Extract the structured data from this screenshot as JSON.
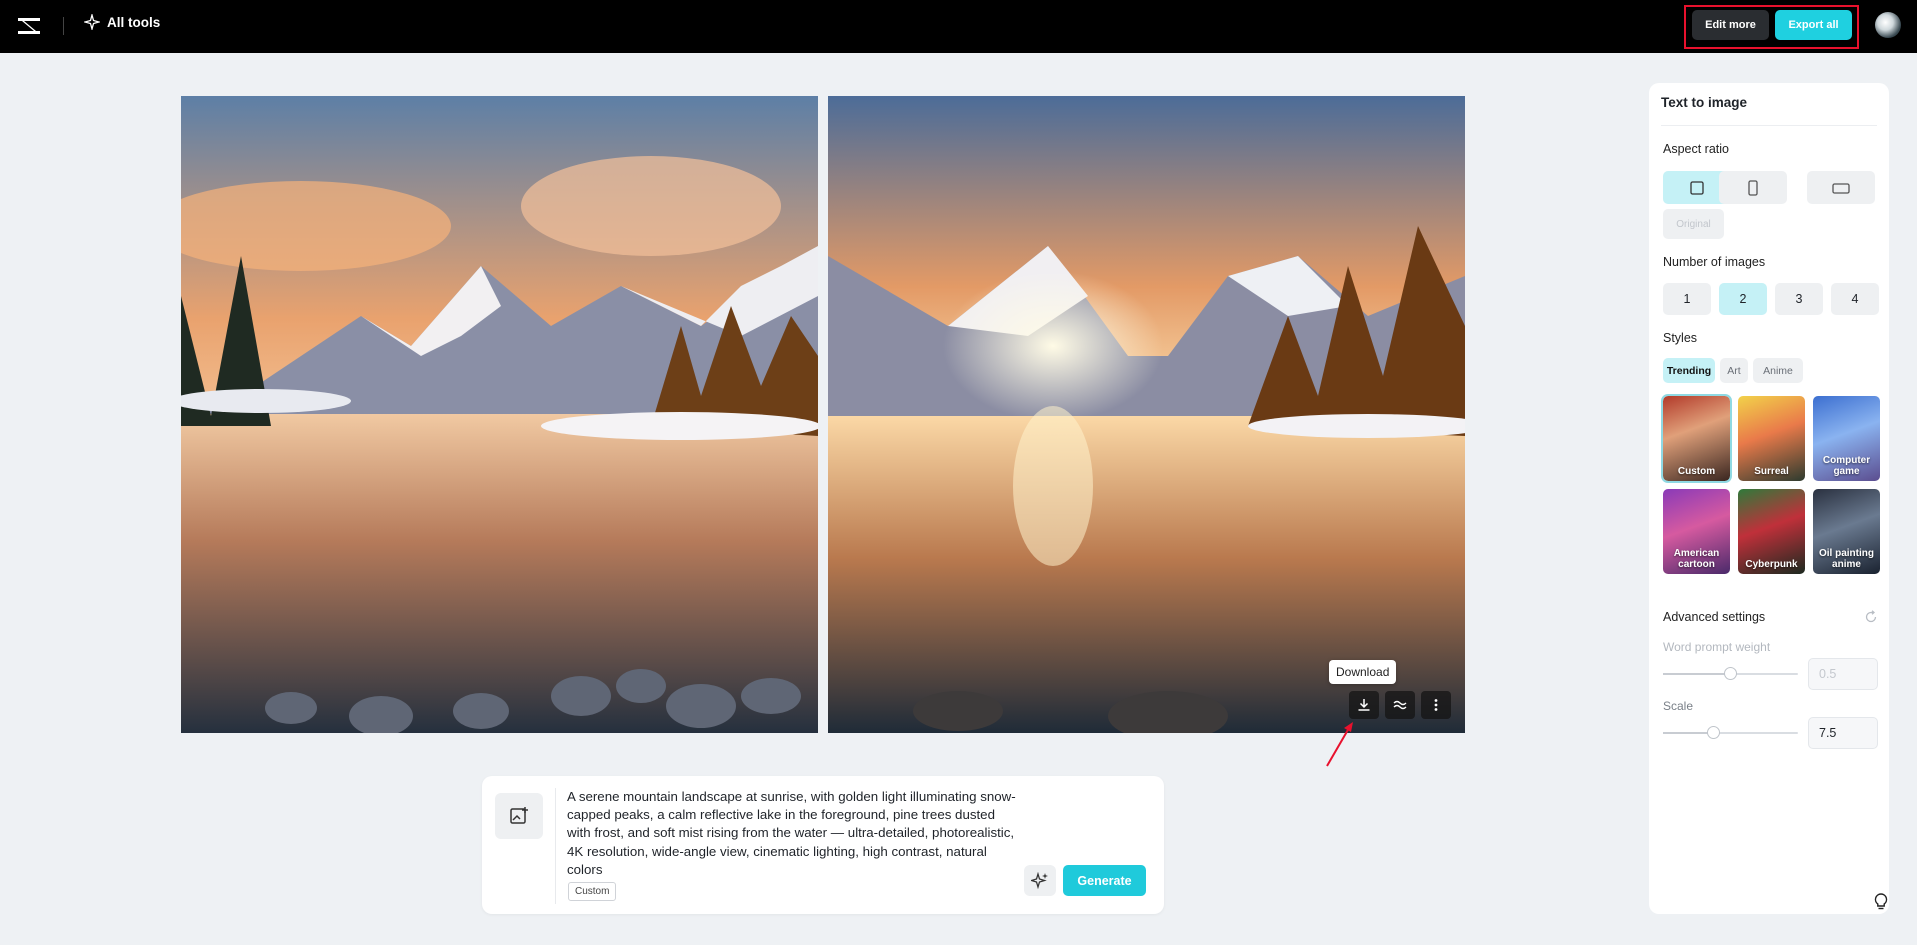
{
  "topbar": {
    "all_tools_label": "All tools",
    "edit_more_label": "Edit more",
    "export_all_label": "Export all"
  },
  "canvas": {
    "tooltip": "Download"
  },
  "prompt": {
    "text": "A serene mountain landscape at sunrise, with golden light illuminating snow-capped peaks, a calm reflective lake in the foreground, pine trees dusted with frost, and soft mist rising from the water — ultra-detailed, photorealistic, 4K resolution, wide-angle view, cinematic lighting, high contrast, natural colors",
    "style_chip": "Custom",
    "generate_label": "Generate"
  },
  "panel": {
    "title": "Text to image",
    "aspect_ratio_label": "Aspect ratio",
    "aspect_original_label": "Original",
    "number_of_images_label": "Number of images",
    "numbers": [
      "1",
      "2",
      "3",
      "4"
    ],
    "selected_number": "2",
    "styles_label": "Styles",
    "style_tabs": [
      "Trending",
      "Art",
      "Anime"
    ],
    "styles": [
      "Custom",
      "Surreal",
      "Computer game",
      "American cartoon",
      "Cyberpunk",
      "Oil painting anime"
    ],
    "advanced_settings_label": "Advanced settings",
    "word_prompt_weight_label": "Word prompt weight",
    "word_prompt_weight_value": "0.5",
    "scale_label": "Scale",
    "scale_value": "7.5"
  },
  "colors": {
    "accent": "#1fd0e0",
    "selected_bg": "#c5f1f6",
    "highlight_box": "#e8112d"
  }
}
